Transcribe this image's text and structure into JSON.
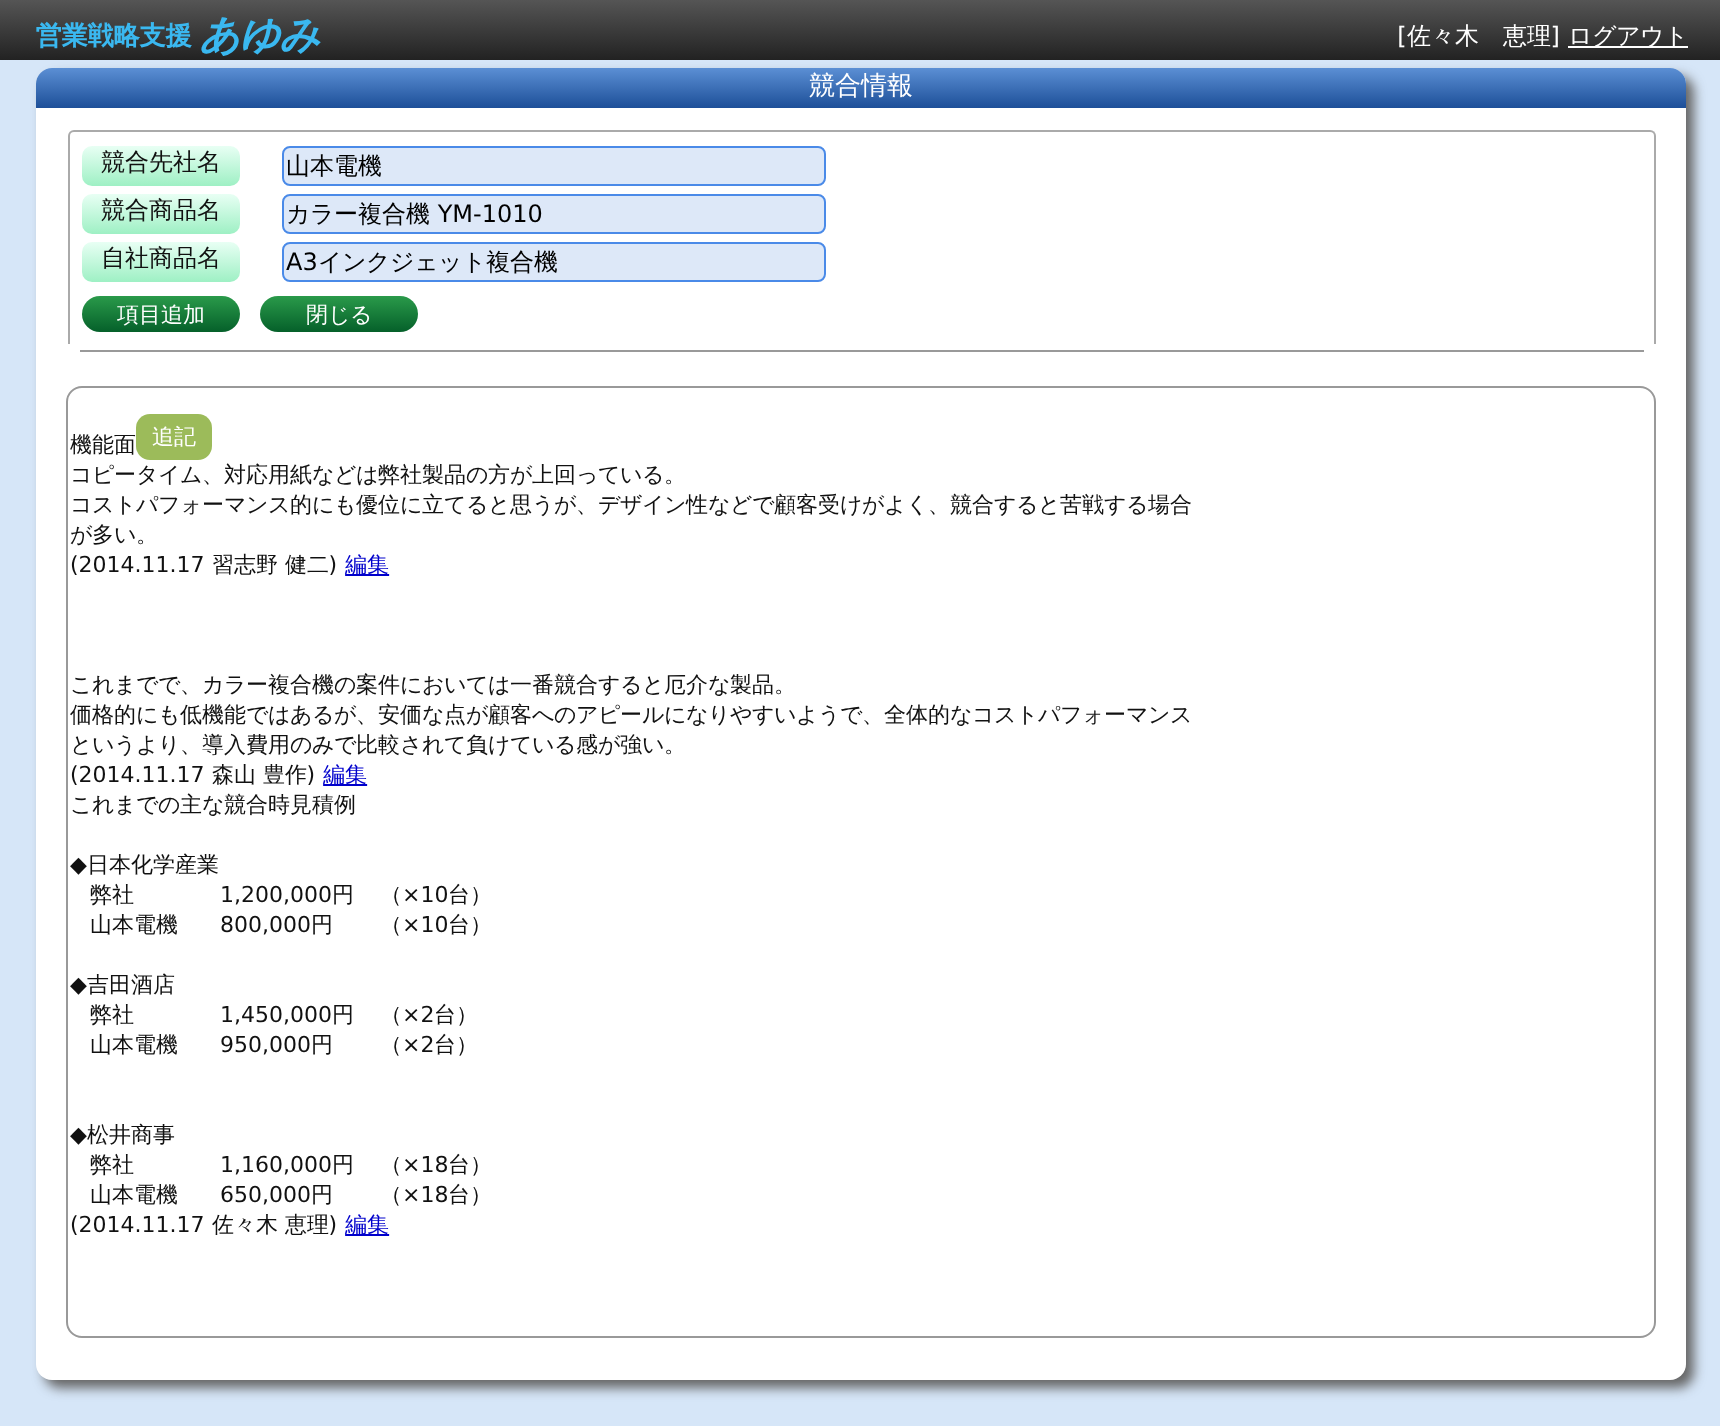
{
  "header": {
    "logo_text": "営業戦略支援",
    "logo_script": "あゆみ",
    "user": "[佐々木　恵理]",
    "logout": "ログアウト"
  },
  "panel": {
    "title": "競合情報"
  },
  "fields": [
    {
      "label": "競合先社名",
      "value": "山本電機"
    },
    {
      "label": "競合商品名",
      "value": "カラー複合機 YM-1010"
    },
    {
      "label": "自社商品名",
      "value": "A3インクジェット複合機"
    }
  ],
  "buttons": [
    "項目追加",
    "閉じる"
  ],
  "notes": {
    "heading": "機能面",
    "badge": "追記",
    "entries": [
      {
        "lines": [
          "コピータイム、対応用紙などは弊社製品の方が上回っている。",
          "コストパフォーマンス的にも優位に立てると思うが、デザイン性などで顧客受けがよく、競合すると苦戦する場合",
          "が多い。"
        ],
        "signature": "(2014.11.17 習志野 健二)",
        "link": "編集"
      },
      {
        "lines": [
          "これまでで、カラー複合機の案件においては一番競合すると厄介な製品。",
          "価格的にも低機能ではあるが、安価な点が顧客へのアピールになりやすいようで、全体的なコストパフォーマンス",
          "というより、導入費用のみで比較されて負けている感が強い。"
        ],
        "signature": "(2014.11.17 森山 豊作)",
        "link": "編集"
      },
      {
        "lines": [
          "これまでの主な競合時見積例"
        ],
        "cases": [
          {
            "title": "◆日本化学産業",
            "rows": [
              {
                "name": "弊社",
                "price": "1,200,000円",
                "qty": "（×10台）"
              },
              {
                "name": "山本電機",
                "price": "800,000円",
                "qty": "（×10台）"
              }
            ]
          },
          {
            "title": "◆吉田酒店",
            "rows": [
              {
                "name": "弊社",
                "price": "1,450,000円",
                "qty": "（×2台）"
              },
              {
                "name": "山本電機",
                "price": "950,000円",
                "qty": "（×2台）"
              }
            ]
          },
          {
            "title": "◆松井商事",
            "rows": [
              {
                "name": "弊社",
                "price": "1,160,000円",
                "qty": "（×18台）"
              },
              {
                "name": "山本電機",
                "price": "650,000円",
                "qty": "（×18台）"
              }
            ]
          }
        ],
        "signature": "(2014.11.17 佐々木 恵理)",
        "link": "編集"
      }
    ]
  }
}
